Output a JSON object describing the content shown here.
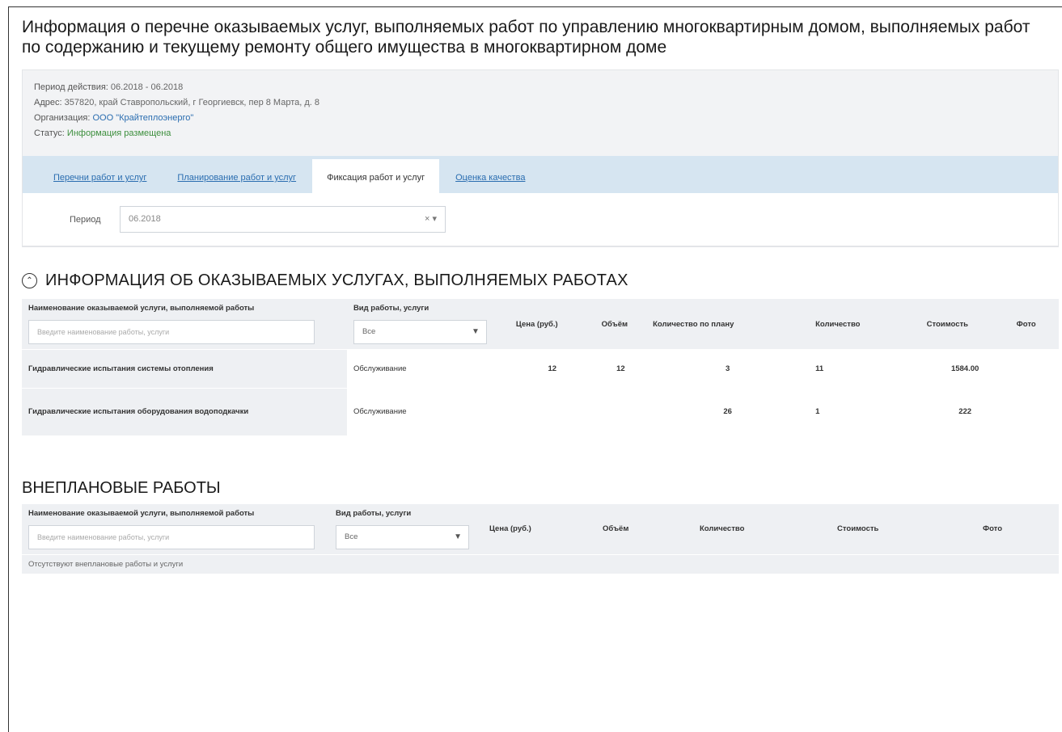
{
  "page": {
    "title": "Информация о перечне оказываемых услуг, выполняемых работ по управлению многоквартирным домом, выполняемых работ по содержанию и текущему ремонту общего имущества в многоквартирном доме"
  },
  "info": {
    "period_label": "Период действия:",
    "period_value": "06.2018 - 06.2018",
    "address_label": "Адрес:",
    "address_value": "357820, край Ставропольский, г Георгиевск, пер 8 Марта, д. 8",
    "org_label": "Организация:",
    "org_value": "ООО \"Крайтеплоэнерго\"",
    "status_label": "Статус:",
    "status_value": "Информация размещена"
  },
  "tabs": [
    {
      "label": "Перечни работ и услуг"
    },
    {
      "label": "Планирование работ и услуг"
    },
    {
      "label": "Фиксация работ и услуг"
    },
    {
      "label": "Оценка качества"
    }
  ],
  "period_filter": {
    "label": "Период",
    "value": "06.2018",
    "clear": "×",
    "arrow": "▾"
  },
  "section1": {
    "title": "ИНФОРМАЦИЯ ОБ ОКАЗЫВАЕМЫХ УСЛУГАХ, ВЫПОЛНЯЕМЫХ РАБОТАХ",
    "collapse_icon": "chevron-up-icon",
    "headers": {
      "name": "Наименование оказываемой услуги, выполняемой работы",
      "kind": "Вид работы, услуги",
      "price": "Цена (руб.)",
      "volume": "Объём",
      "qty_plan": "Количество по плану",
      "qty": "Количество",
      "cost": "Стоимость",
      "photo": "Фото"
    },
    "name_placeholder": "Введите наименование работы, услуги",
    "kind_select": "Все",
    "rows": [
      {
        "name": "Гидравлические испытания системы отопления",
        "kind": "Обслуживание",
        "price": "12",
        "volume": "12",
        "qty_plan": "3",
        "qty": "11",
        "cost": "1584.00",
        "photo": ""
      },
      {
        "name": "Гидравлические испытания оборудования водоподкачки",
        "kind": "Обслуживание",
        "price": "",
        "volume": "",
        "qty_plan": "26",
        "qty": "1",
        "cost": "222",
        "photo": ""
      }
    ]
  },
  "section2": {
    "title": "ВНЕПЛАНОВЫЕ РАБОТЫ",
    "headers": {
      "name": "Наименование оказываемой услуги, выполняемой работы",
      "kind": "Вид работы, услуги",
      "price": "Цена (руб.)",
      "volume": "Объём",
      "qty": "Количество",
      "cost": "Стоимость",
      "photo": "Фото"
    },
    "name_placeholder": "Введите наименование работы, услуги",
    "kind_select": "Все",
    "empty_text": "Отсутствуют внеплановые работы и услуги"
  }
}
